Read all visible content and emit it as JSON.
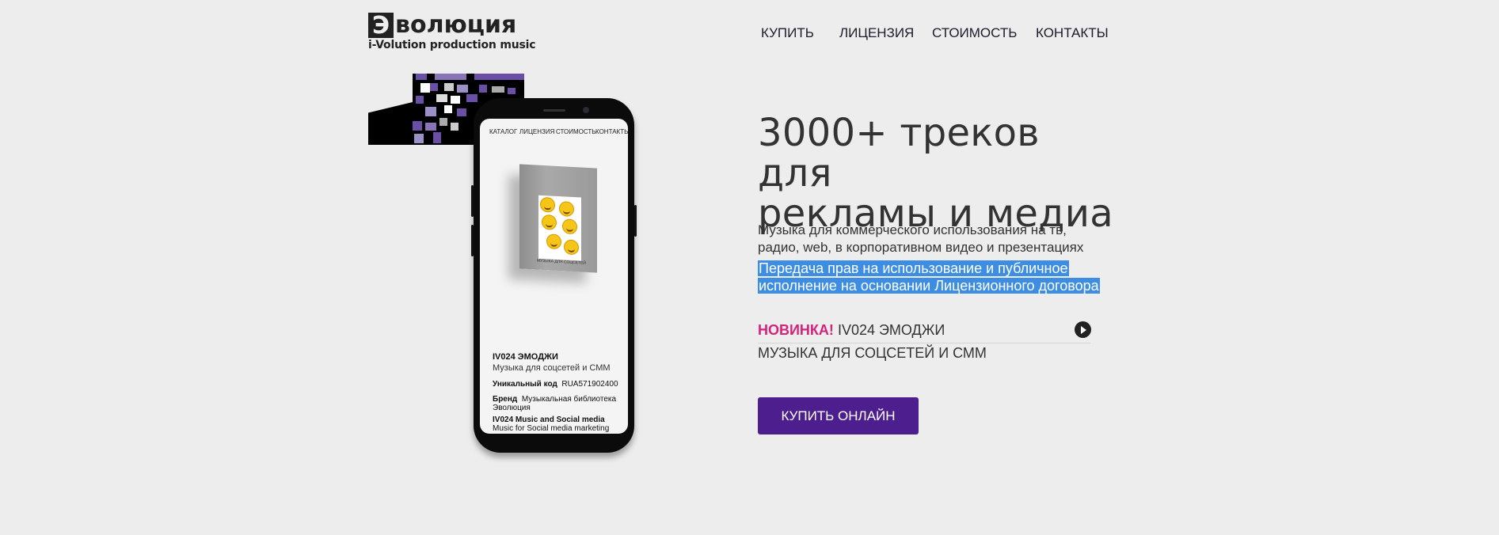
{
  "logo": {
    "mark": "Э",
    "word": "волюция",
    "subtitle": "i-Volution production music"
  },
  "nav": {
    "items": [
      "КУПИТЬ",
      "ЛИЦЕНЗИЯ",
      "СТОИМОСТЬ",
      "КОНТАКТЫ"
    ]
  },
  "phone": {
    "nav": [
      "КАТАЛОГ",
      "ЛИЦЕНЗИЯ",
      "СТОИМОСТЬ",
      "КОНТАКТЫ"
    ],
    "album_caption": "МУЗЫКА ДЛЯ СОЦСЕТЕЙ",
    "title": "IV024 ЭМОДЖИ",
    "subtitle": "Музыка для соцсетей и СММ",
    "code_label": "Уникальный код",
    "code_value": "RUA571902400",
    "brand_label": "Бренд",
    "brand_value_1": "Музыкальная библиотека",
    "brand_value_2": "Эволюция",
    "en_title": "IV024 Music and Social media",
    "en_subtitle": "Music for Social media marketing"
  },
  "hero": {
    "title_line1": "3000+ треков для",
    "title_line2": "рекламы и медиа",
    "desc_line1": "Музыка для коммерческого использования на тв,",
    "desc_line2": "радио, web, в корпоративном видео и презентациях",
    "license_line1": "Передача прав на использование и публичное",
    "license_line2": "исполнение на основании Лицензионного договора"
  },
  "new_release": {
    "badge": "НОВИНКА!",
    "title": "IV024 ЭМОДЖИ",
    "subtitle": "МУЗЫКА ДЛЯ СОЦСЕТЕЙ И СММ",
    "icon": "play-circle-icon"
  },
  "cta": {
    "buy_label": "КУПИТЬ ОНЛАЙН"
  },
  "colors": {
    "background": "#ededed",
    "accent_purple": "#4d1f8e",
    "new_badge": "#d4237a",
    "selection": "#3d8ee2",
    "mosaic_purple": "#6a4fa6"
  }
}
